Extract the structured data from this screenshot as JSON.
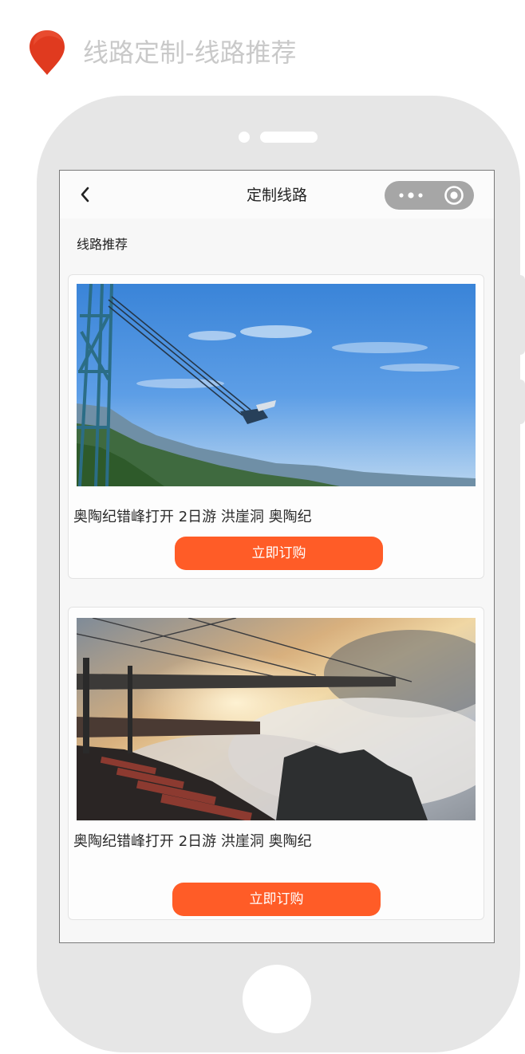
{
  "header": {
    "title": "线路定制-线路推荐",
    "pin_color": "#e03a1f"
  },
  "navbar": {
    "title": "定制线路",
    "back_icon": "chevron-left-icon",
    "menu_icon": "more-dots-icon",
    "close_icon": "target-circle-icon"
  },
  "section": {
    "title": "线路推荐"
  },
  "routes": [
    {
      "title": "奥陶纪错峰打开  2日游  洪崖洞  奥陶纪",
      "image": "cliff-swing-over-valley",
      "button": "立即订购"
    },
    {
      "title": "奥陶纪错峰打开  2日游  洪崖洞  奥陶纪",
      "image": "sunset-sky-bridge-above-clouds",
      "button": "立即订购"
    }
  ],
  "colors": {
    "accent": "#ff5c27",
    "phone_frame": "#e6e6e6",
    "capsule": "#a6a6a6",
    "heading": "#c9c9c9"
  }
}
